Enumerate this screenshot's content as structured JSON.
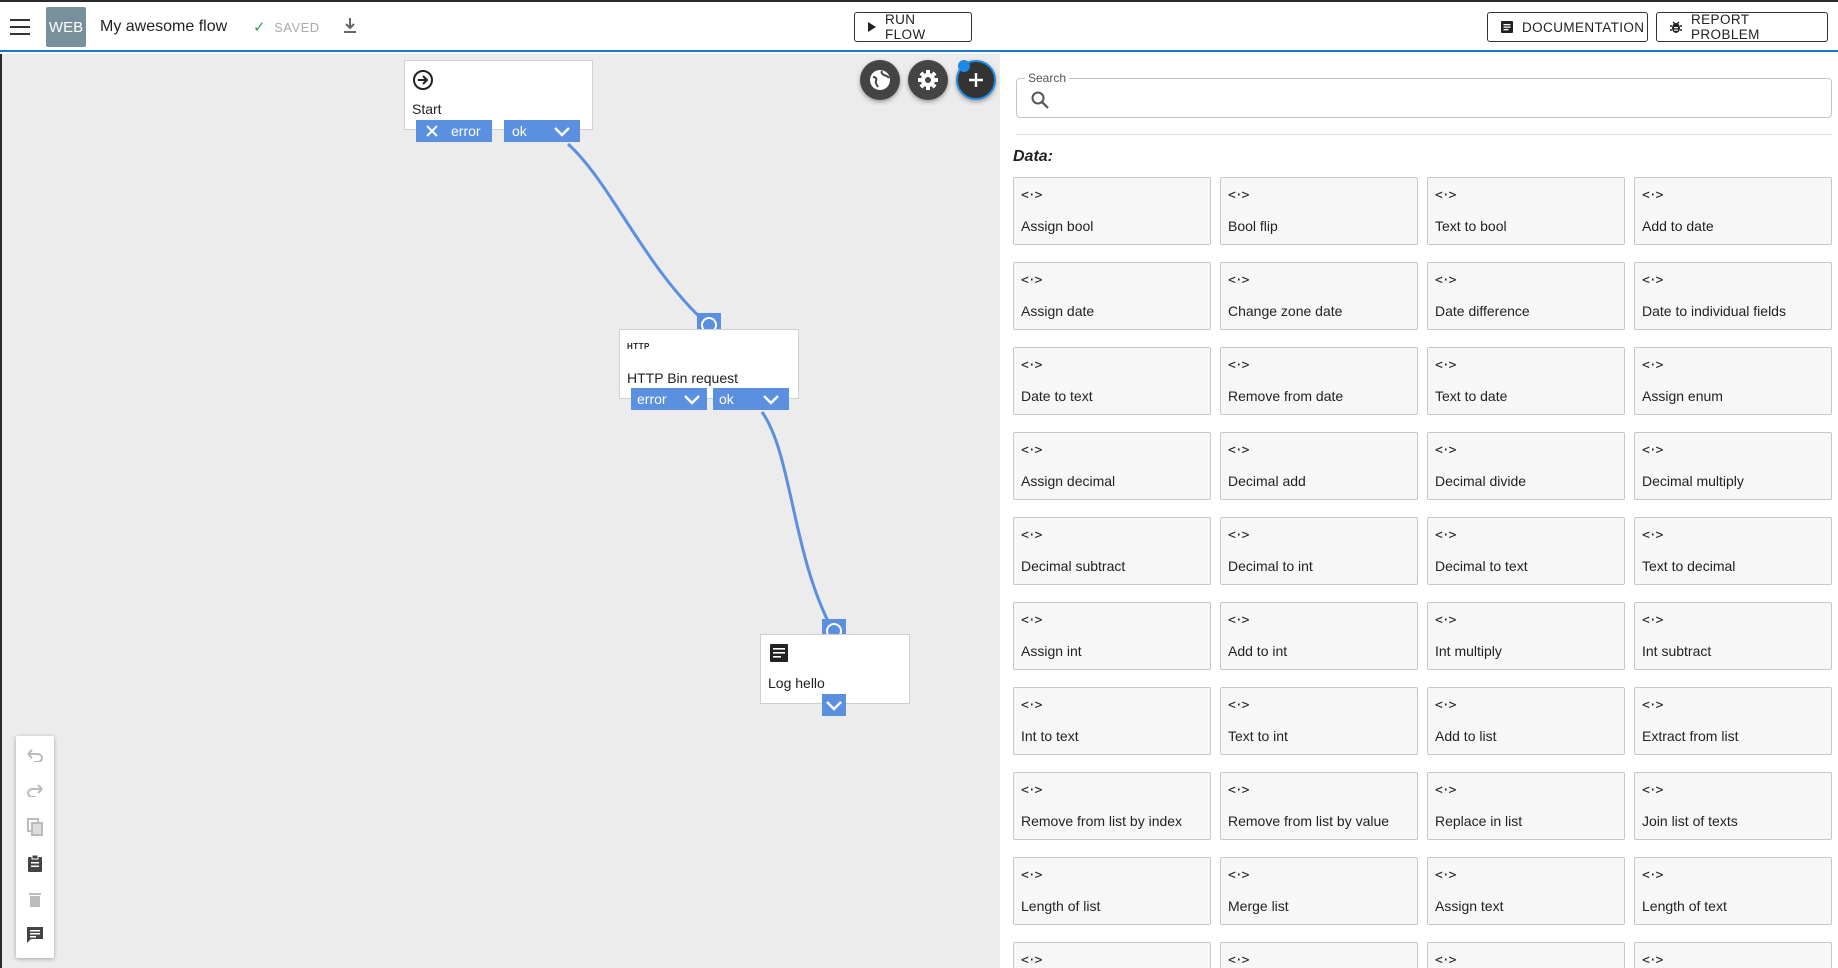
{
  "header": {
    "app_badge": "WEB",
    "flow_title": "My awesome flow",
    "saved_label": "SAVED",
    "run_label": "RUN FLOW",
    "documentation_label": "DOCUMENTATION",
    "report_label": "REPORT PROBLEM"
  },
  "colors": {
    "accent": "#1976d2",
    "port": "#5b8fe0",
    "badge": "#78909c",
    "canvas": "#ececec"
  },
  "canvas": {
    "nodes": {
      "start": {
        "label": "Start",
        "error_label": "error",
        "ok_label": "ok",
        "icon": "arrow-circle-icon"
      },
      "http": {
        "label": "HTTP Bin request",
        "badge": "HTTP",
        "error_label": "error",
        "ok_label": "ok"
      },
      "log": {
        "label": "Log hello",
        "icon": "log-document-icon"
      }
    },
    "edges": [
      {
        "from": "start.ok",
        "to": "http.in"
      },
      {
        "from": "http.ok",
        "to": "log.in"
      }
    ],
    "fab_icons": [
      "globe-icon",
      "gear-icon",
      "plus-icon"
    ],
    "tools": [
      "undo-icon",
      "redo-icon",
      "copy-icon",
      "paste-icon",
      "delete-icon",
      "comment-icon"
    ]
  },
  "panel": {
    "search_legend": "Search",
    "search_value": "",
    "section_title": "Data:",
    "card_icon_text": "<·>",
    "blocks": [
      "Assign bool",
      "Bool flip",
      "Text to bool",
      "Add to date",
      "Assign date",
      "Change zone date",
      "Date difference",
      "Date to individual fields",
      "Date to text",
      "Remove from date",
      "Text to date",
      "Assign enum",
      "Assign decimal",
      "Decimal add",
      "Decimal divide",
      "Decimal multiply",
      "Decimal subtract",
      "Decimal to int",
      "Decimal to text",
      "Text to decimal",
      "Assign int",
      "Add to int",
      "Int multiply",
      "Int subtract",
      "Int to text",
      "Text to int",
      "Add to list",
      "Extract from list",
      "Remove from list by index",
      "Remove from list by value",
      "Replace in list",
      "Join list of texts",
      "Length of list",
      "Merge list",
      "Assign text",
      "Length of text",
      "",
      "",
      "",
      ""
    ]
  }
}
